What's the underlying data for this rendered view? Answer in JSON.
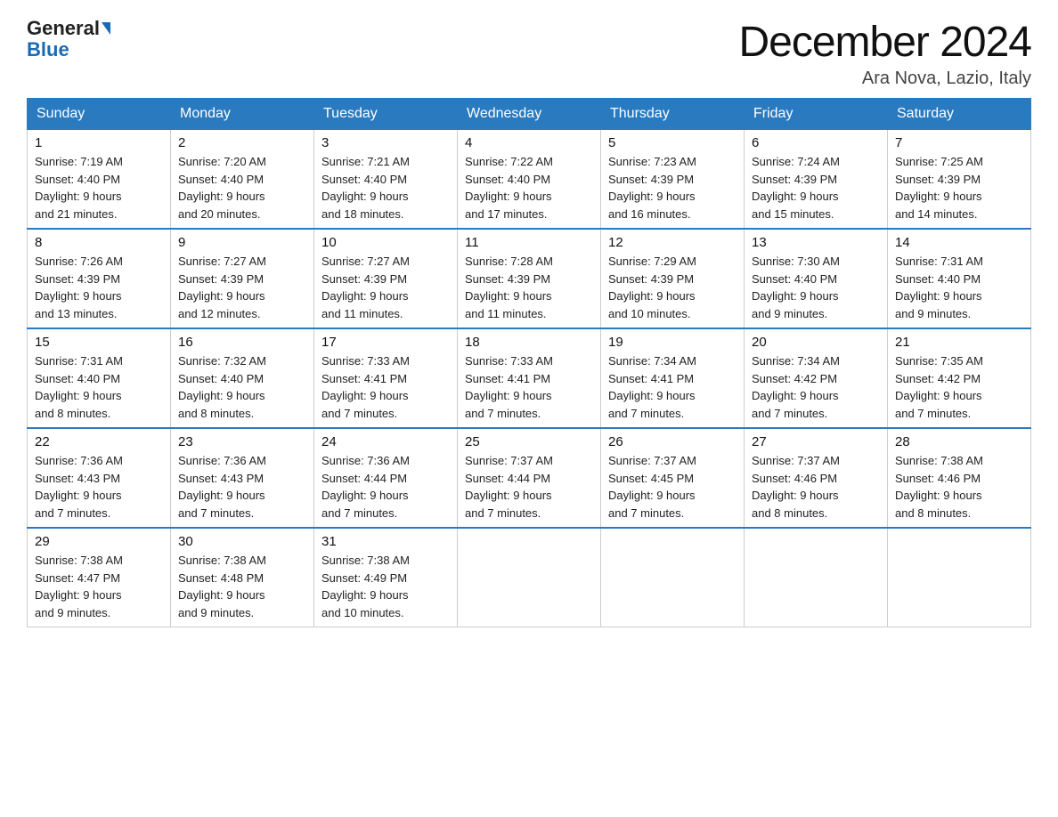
{
  "logo": {
    "general": "General",
    "blue": "Blue",
    "triangle": true
  },
  "title": {
    "month_year": "December 2024",
    "location": "Ara Nova, Lazio, Italy"
  },
  "header_days": [
    "Sunday",
    "Monday",
    "Tuesday",
    "Wednesday",
    "Thursday",
    "Friday",
    "Saturday"
  ],
  "weeks": [
    [
      {
        "day": "1",
        "sunrise": "7:19 AM",
        "sunset": "4:40 PM",
        "daylight": "9 hours and 21 minutes."
      },
      {
        "day": "2",
        "sunrise": "7:20 AM",
        "sunset": "4:40 PM",
        "daylight": "9 hours and 20 minutes."
      },
      {
        "day": "3",
        "sunrise": "7:21 AM",
        "sunset": "4:40 PM",
        "daylight": "9 hours and 18 minutes."
      },
      {
        "day": "4",
        "sunrise": "7:22 AM",
        "sunset": "4:40 PM",
        "daylight": "9 hours and 17 minutes."
      },
      {
        "day": "5",
        "sunrise": "7:23 AM",
        "sunset": "4:39 PM",
        "daylight": "9 hours and 16 minutes."
      },
      {
        "day": "6",
        "sunrise": "7:24 AM",
        "sunset": "4:39 PM",
        "daylight": "9 hours and 15 minutes."
      },
      {
        "day": "7",
        "sunrise": "7:25 AM",
        "sunset": "4:39 PM",
        "daylight": "9 hours and 14 minutes."
      }
    ],
    [
      {
        "day": "8",
        "sunrise": "7:26 AM",
        "sunset": "4:39 PM",
        "daylight": "9 hours and 13 minutes."
      },
      {
        "day": "9",
        "sunrise": "7:27 AM",
        "sunset": "4:39 PM",
        "daylight": "9 hours and 12 minutes."
      },
      {
        "day": "10",
        "sunrise": "7:27 AM",
        "sunset": "4:39 PM",
        "daylight": "9 hours and 11 minutes."
      },
      {
        "day": "11",
        "sunrise": "7:28 AM",
        "sunset": "4:39 PM",
        "daylight": "9 hours and 11 minutes."
      },
      {
        "day": "12",
        "sunrise": "7:29 AM",
        "sunset": "4:39 PM",
        "daylight": "9 hours and 10 minutes."
      },
      {
        "day": "13",
        "sunrise": "7:30 AM",
        "sunset": "4:40 PM",
        "daylight": "9 hours and 9 minutes."
      },
      {
        "day": "14",
        "sunrise": "7:31 AM",
        "sunset": "4:40 PM",
        "daylight": "9 hours and 9 minutes."
      }
    ],
    [
      {
        "day": "15",
        "sunrise": "7:31 AM",
        "sunset": "4:40 PM",
        "daylight": "9 hours and 8 minutes."
      },
      {
        "day": "16",
        "sunrise": "7:32 AM",
        "sunset": "4:40 PM",
        "daylight": "9 hours and 8 minutes."
      },
      {
        "day": "17",
        "sunrise": "7:33 AM",
        "sunset": "4:41 PM",
        "daylight": "9 hours and 7 minutes."
      },
      {
        "day": "18",
        "sunrise": "7:33 AM",
        "sunset": "4:41 PM",
        "daylight": "9 hours and 7 minutes."
      },
      {
        "day": "19",
        "sunrise": "7:34 AM",
        "sunset": "4:41 PM",
        "daylight": "9 hours and 7 minutes."
      },
      {
        "day": "20",
        "sunrise": "7:34 AM",
        "sunset": "4:42 PM",
        "daylight": "9 hours and 7 minutes."
      },
      {
        "day": "21",
        "sunrise": "7:35 AM",
        "sunset": "4:42 PM",
        "daylight": "9 hours and 7 minutes."
      }
    ],
    [
      {
        "day": "22",
        "sunrise": "7:36 AM",
        "sunset": "4:43 PM",
        "daylight": "9 hours and 7 minutes."
      },
      {
        "day": "23",
        "sunrise": "7:36 AM",
        "sunset": "4:43 PM",
        "daylight": "9 hours and 7 minutes."
      },
      {
        "day": "24",
        "sunrise": "7:36 AM",
        "sunset": "4:44 PM",
        "daylight": "9 hours and 7 minutes."
      },
      {
        "day": "25",
        "sunrise": "7:37 AM",
        "sunset": "4:44 PM",
        "daylight": "9 hours and 7 minutes."
      },
      {
        "day": "26",
        "sunrise": "7:37 AM",
        "sunset": "4:45 PM",
        "daylight": "9 hours and 7 minutes."
      },
      {
        "day": "27",
        "sunrise": "7:37 AM",
        "sunset": "4:46 PM",
        "daylight": "9 hours and 8 minutes."
      },
      {
        "day": "28",
        "sunrise": "7:38 AM",
        "sunset": "4:46 PM",
        "daylight": "9 hours and 8 minutes."
      }
    ],
    [
      {
        "day": "29",
        "sunrise": "7:38 AM",
        "sunset": "4:47 PM",
        "daylight": "9 hours and 9 minutes."
      },
      {
        "day": "30",
        "sunrise": "7:38 AM",
        "sunset": "4:48 PM",
        "daylight": "9 hours and 9 minutes."
      },
      {
        "day": "31",
        "sunrise": "7:38 AM",
        "sunset": "4:49 PM",
        "daylight": "9 hours and 10 minutes."
      },
      null,
      null,
      null,
      null
    ]
  ],
  "labels": {
    "sunrise": "Sunrise:",
    "sunset": "Sunset:",
    "daylight": "Daylight:"
  }
}
